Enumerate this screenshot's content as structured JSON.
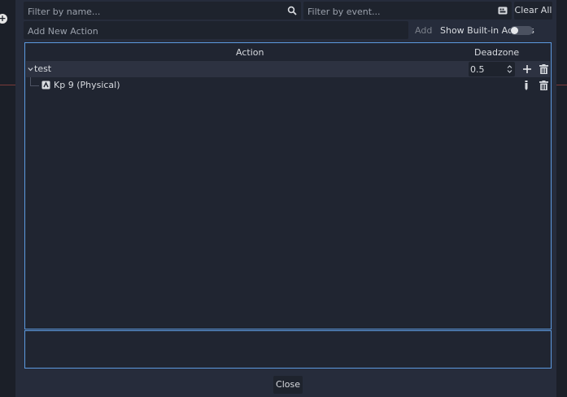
{
  "filters": {
    "name_placeholder": "Filter by name...",
    "event_placeholder": "Filter by event...",
    "clear_all_label": "Clear All",
    "search_icon": "search-icon",
    "event_icon": "keyboard-icon"
  },
  "add_action": {
    "placeholder": "Add New Action",
    "add_label": "Add",
    "builtin_label": "Show Built-in Actions",
    "builtin_enabled": false
  },
  "table": {
    "col_action": "Action",
    "col_deadzone": "Deadzone",
    "actions": [
      {
        "name": "test",
        "deadzone": "0.5",
        "expanded": true,
        "events": [
          {
            "label": "Kp 9 (Physical)",
            "icon": "keyboard-key-icon"
          }
        ]
      }
    ]
  },
  "footer": {
    "close_label": "Close"
  },
  "colors": {
    "accent": "#5c9ae0",
    "panel": "#262c3b",
    "field": "#1e232d"
  }
}
